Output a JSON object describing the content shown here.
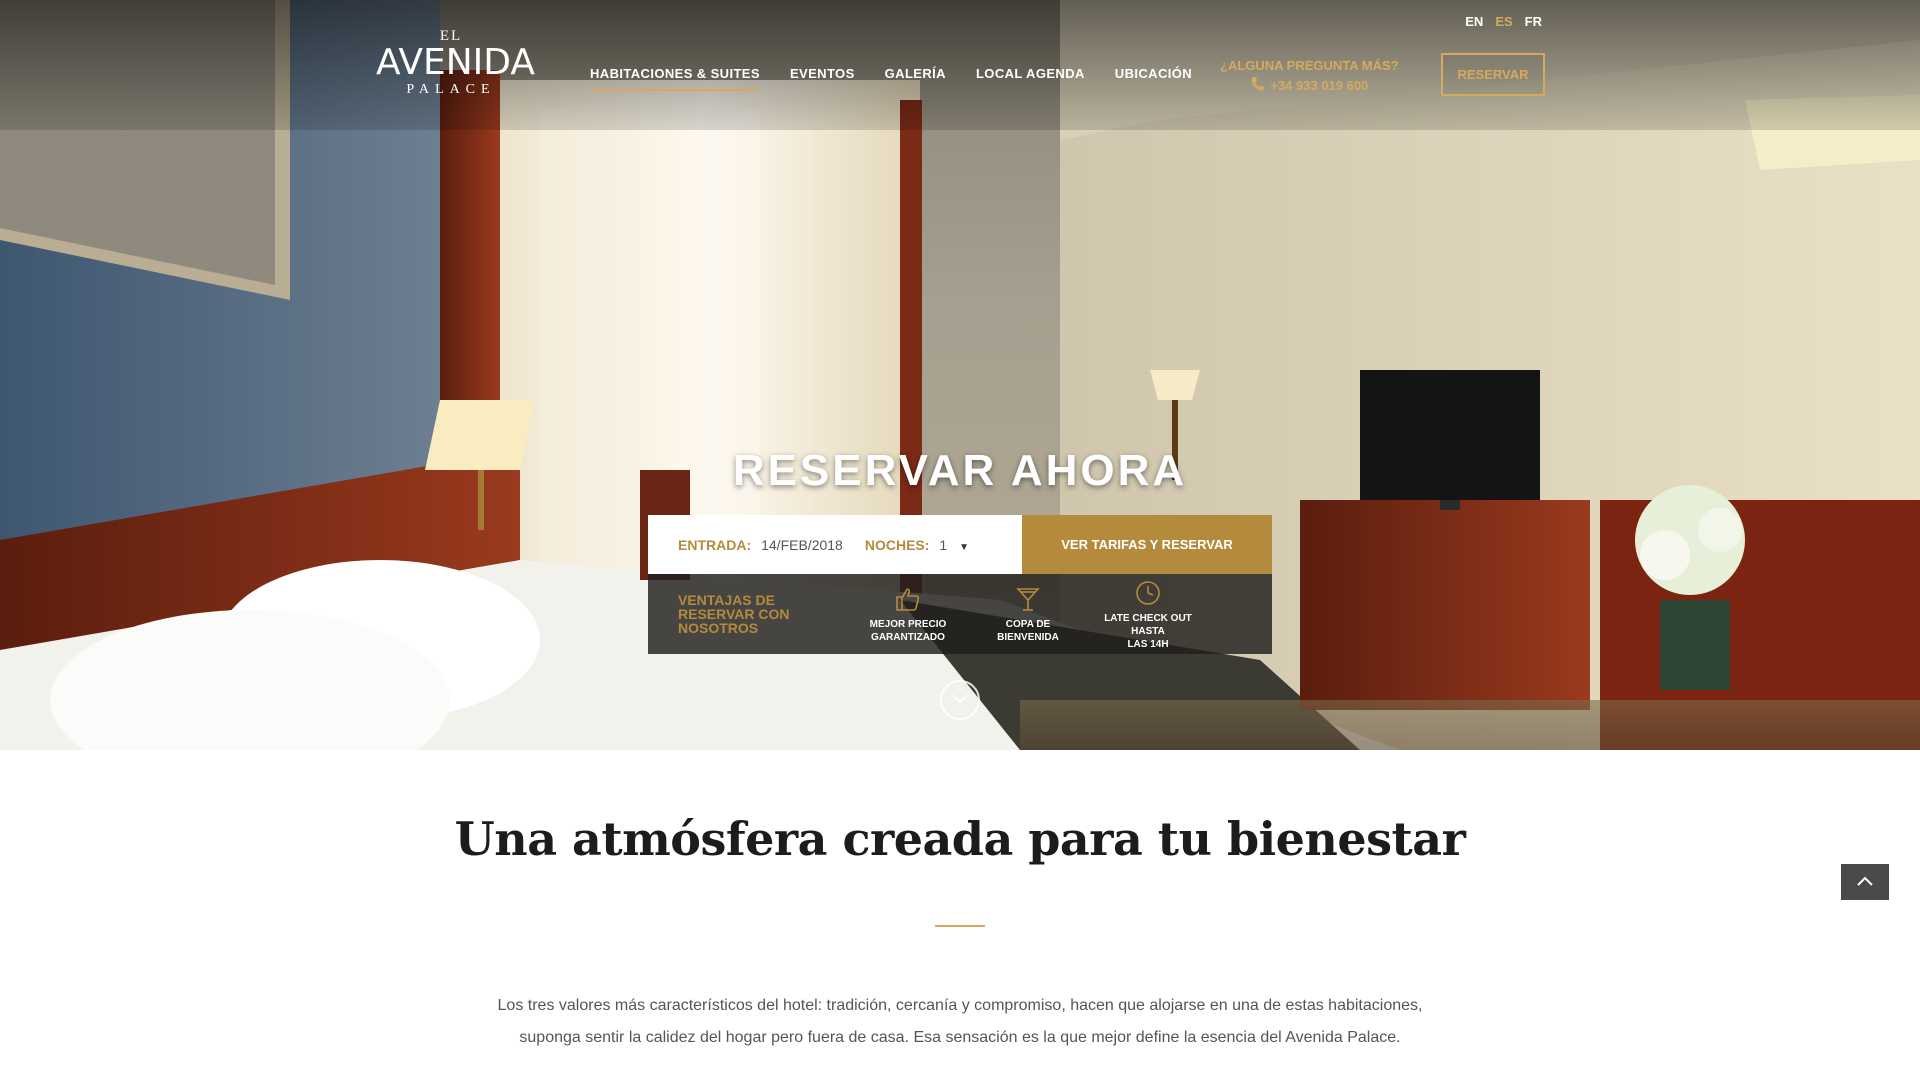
{
  "languages": [
    {
      "label": "EN",
      "active": false
    },
    {
      "label": "ES",
      "active": true
    },
    {
      "label": "FR",
      "active": false
    }
  ],
  "logo": {
    "top": "EL",
    "main": "AVENIDA",
    "bottom": "PALACE"
  },
  "nav": [
    {
      "label": "HABITACIONES & SUITES",
      "active": true
    },
    {
      "label": "EVENTOS",
      "active": false
    },
    {
      "label": "GALERÍA",
      "active": false
    },
    {
      "label": "LOCAL AGENDA",
      "active": false
    },
    {
      "label": "UBICACIÓN",
      "active": false
    }
  ],
  "contact": {
    "question": "¿ALGUNA PREGUNTA MÁS?",
    "phone": "+34 933 019 600"
  },
  "header_button": "RESERVAR",
  "booking": {
    "title": "RESERVAR AHORA",
    "entry_label": "ENTRADA:",
    "entry_value": "14/FEB/2018",
    "nights_label": "NOCHES:",
    "nights_value": "1",
    "submit_label": "VER TARIFAS Y RESERVAR"
  },
  "advantages": {
    "title": "VENTAJAS DE RESERVAR CON NOSOTROS",
    "items": [
      {
        "icon": "thumbs-up-icon",
        "line1": "MEJOR PRECIO",
        "line2": "GARANTIZADO"
      },
      {
        "icon": "cocktail-glass-icon",
        "line1": "COPA DE",
        "line2": "BIENVENIDA"
      },
      {
        "icon": "clock-icon",
        "line1": "LATE CHECK OUT HASTA",
        "line2": "LAS 14H"
      }
    ]
  },
  "content": {
    "heading": "Una atmósfera creada para tu bienestar",
    "paragraph_line1": "Los tres valores más característicos del hotel: tradición, cercanía y compromiso, hacen que alojarse en una de estas habitaciones,",
    "paragraph_line2": "suponga sentir la calidez del hogar pero fuera de casa. Esa sensación es la que mejor define la esencia del Avenida Palace."
  },
  "colors": {
    "accent": "#d3ab5f",
    "accent_dark": "#b48a3c",
    "heading": "#1c1c1c"
  }
}
